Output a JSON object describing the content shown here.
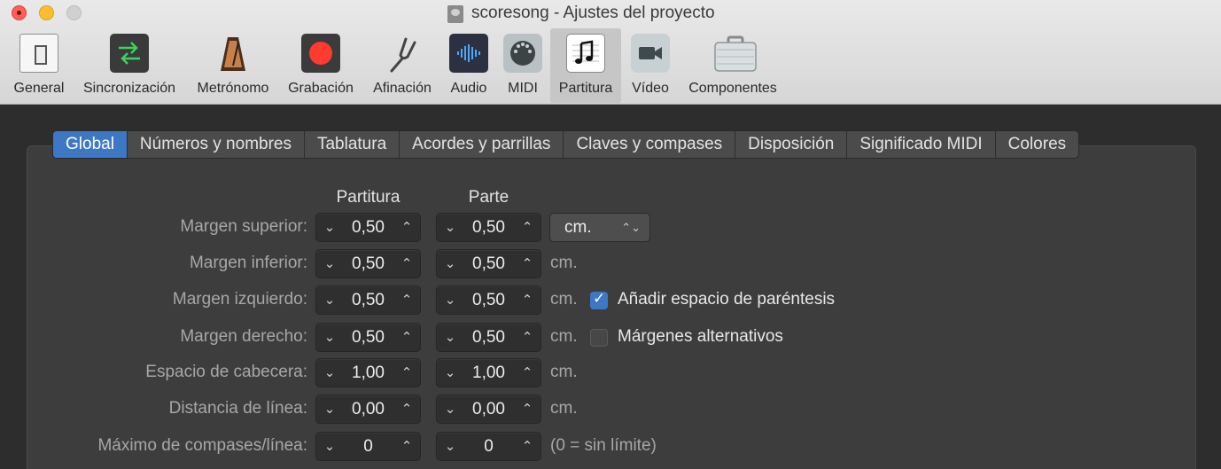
{
  "window": {
    "title": "scoresong - Ajustes del proyecto"
  },
  "toolbar": {
    "items": [
      {
        "label": "General",
        "icon": "general-switch-icon"
      },
      {
        "label": "Sincronización",
        "icon": "sync-arrows-icon"
      },
      {
        "label": "Metrónomo",
        "icon": "metronome-icon"
      },
      {
        "label": "Grabación",
        "icon": "record-icon"
      },
      {
        "label": "Afinación",
        "icon": "tuning-fork-icon"
      },
      {
        "label": "Audio",
        "icon": "audio-waveform-icon"
      },
      {
        "label": "MIDI",
        "icon": "midi-plug-icon"
      },
      {
        "label": "Partitura",
        "icon": "music-note-icon",
        "selected": true
      },
      {
        "label": "Vídeo",
        "icon": "video-camera-icon"
      },
      {
        "label": "Componentes",
        "icon": "briefcase-icon"
      }
    ]
  },
  "tabs": [
    {
      "label": "Global",
      "active": true
    },
    {
      "label": "Números y nombres"
    },
    {
      "label": "Tablatura"
    },
    {
      "label": "Acordes y parrillas"
    },
    {
      "label": "Claves y compases"
    },
    {
      "label": "Disposición"
    },
    {
      "label": "Significado MIDI"
    },
    {
      "label": "Colores"
    }
  ],
  "columns": {
    "score": "Partitura",
    "part": "Parte"
  },
  "rows": [
    {
      "label": "Margen superior:",
      "score": "0,50",
      "part": "0,50"
    },
    {
      "label": "Margen inferior:",
      "score": "0,50",
      "part": "0,50",
      "unit": "cm."
    },
    {
      "label": "Margen izquierdo:",
      "score": "0,50",
      "part": "0,50",
      "unit": "cm."
    },
    {
      "label": "Margen derecho:",
      "score": "0,50",
      "part": "0,50",
      "unit": "cm."
    },
    {
      "label": "Espacio de cabecera:",
      "score": "1,00",
      "part": "1,00",
      "unit": "cm."
    },
    {
      "label": "Distancia de línea:",
      "score": "0,00",
      "part": "0,00",
      "unit": "cm."
    },
    {
      "label": "Máximo de compases/línea:",
      "score": "0",
      "part": "0",
      "unit": "(0 = sin límite)"
    }
  ],
  "unit_select": {
    "value": "cm."
  },
  "checkboxes": {
    "bracket_space": {
      "label": "Añadir espacio de paréntesis",
      "checked": true
    },
    "alternate_margins": {
      "label": "Márgenes alternativos",
      "checked": false
    }
  },
  "colors": {
    "accent": "#3d78c6",
    "record": "#ff3b30"
  }
}
